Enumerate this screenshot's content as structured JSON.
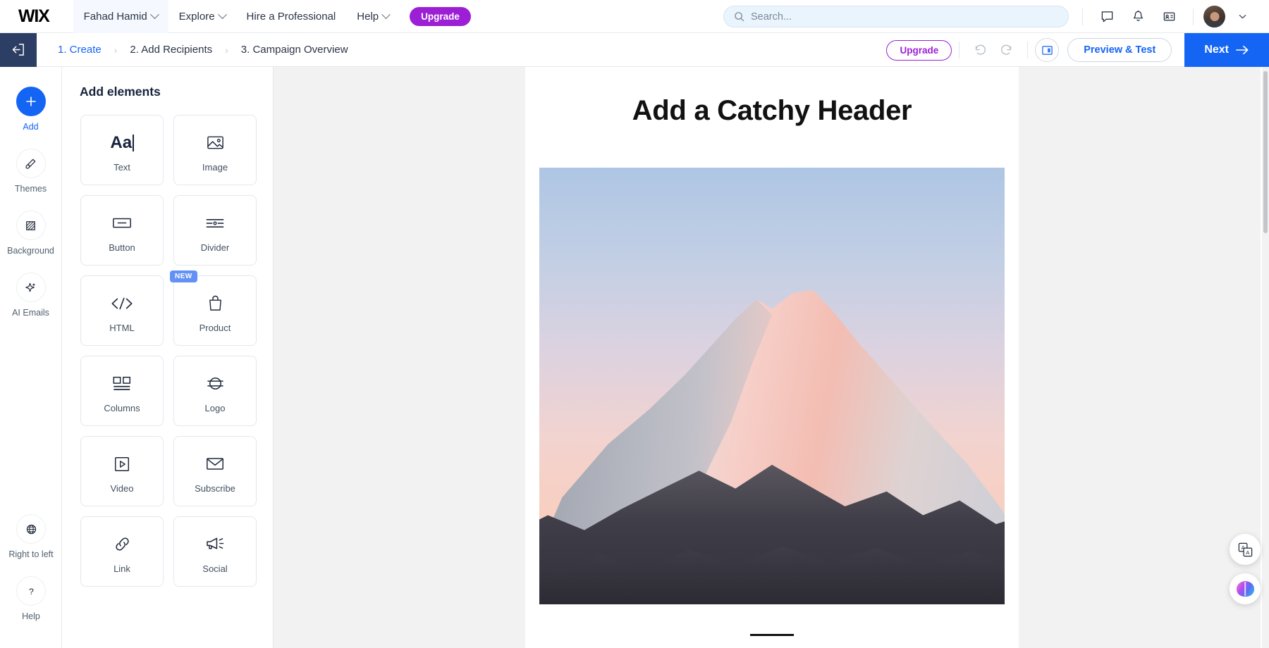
{
  "topbar": {
    "logo": "WIX",
    "nav": [
      {
        "label": "Fahad Hamid",
        "has_chevron": true,
        "boxed": true
      },
      {
        "label": "Explore",
        "has_chevron": true,
        "boxed": false
      },
      {
        "label": "Hire a Professional",
        "has_chevron": false,
        "boxed": false
      },
      {
        "label": "Help",
        "has_chevron": true,
        "boxed": false
      }
    ],
    "upgrade_label": "Upgrade",
    "search_placeholder": "Search...",
    "icons": [
      "chat-icon",
      "bell-icon",
      "contact-card-icon"
    ],
    "avatar_name": "avatar"
  },
  "editorbar": {
    "back_icon": "exit-arrow-icon",
    "steps": [
      {
        "label": "1. Create",
        "active": true
      },
      {
        "label": "2. Add Recipients",
        "active": false
      },
      {
        "label": "3. Campaign Overview",
        "active": false
      }
    ],
    "separator": "›",
    "upgrade_label": "Upgrade",
    "undo_icon": "undo-icon",
    "redo_icon": "redo-icon",
    "layout_icon": "layout-panel-icon",
    "preview_label": "Preview & Test",
    "next_label": "Next"
  },
  "rail": {
    "top_items": [
      {
        "label": "Add",
        "icon": "plus-icon",
        "active": true
      },
      {
        "label": "Themes",
        "icon": "brush-icon",
        "active": false
      },
      {
        "label": "Background",
        "icon": "hatched-square-icon",
        "active": false
      },
      {
        "label": "AI Emails",
        "icon": "sparkle-icon",
        "active": false
      }
    ],
    "bottom_items": [
      {
        "label": "Right to left",
        "icon": "globe-icon"
      },
      {
        "label": "Help",
        "icon": "question-mark-icon"
      }
    ]
  },
  "panel": {
    "title": "Add elements",
    "elements": [
      {
        "label": "Text",
        "icon": "text-aa-icon",
        "badge": null
      },
      {
        "label": "Image",
        "icon": "image-icon",
        "badge": null
      },
      {
        "label": "Button",
        "icon": "button-icon",
        "badge": null
      },
      {
        "label": "Divider",
        "icon": "divider-icon",
        "badge": null
      },
      {
        "label": "HTML",
        "icon": "code-icon",
        "badge": null
      },
      {
        "label": "Product",
        "icon": "shopping-bag-icon",
        "badge": "NEW"
      },
      {
        "label": "Columns",
        "icon": "columns-icon",
        "badge": null
      },
      {
        "label": "Logo",
        "icon": "logo-icon",
        "badge": null
      },
      {
        "label": "Video",
        "icon": "video-play-icon",
        "badge": null
      },
      {
        "label": "Subscribe",
        "icon": "envelope-icon",
        "badge": null
      },
      {
        "label": "Link",
        "icon": "chain-link-icon",
        "badge": null
      },
      {
        "label": "Social",
        "icon": "megaphone-icon",
        "badge": null
      }
    ]
  },
  "canvas": {
    "header_text": "Add a Catchy Header",
    "image_alt": "snowy-mountain-peak-at-sunset"
  },
  "floating": [
    {
      "name": "translate-button",
      "icon": "translate-icon"
    },
    {
      "name": "ai-assistant-button",
      "icon": "brain-icon"
    }
  ],
  "colors": {
    "accent_blue": "#1565f5",
    "upgrade_purple": "#9c1fd6",
    "back_navy": "#2c3e63",
    "badge_blue": "#6391f5",
    "canvas_gray": "#f2f2f2"
  }
}
